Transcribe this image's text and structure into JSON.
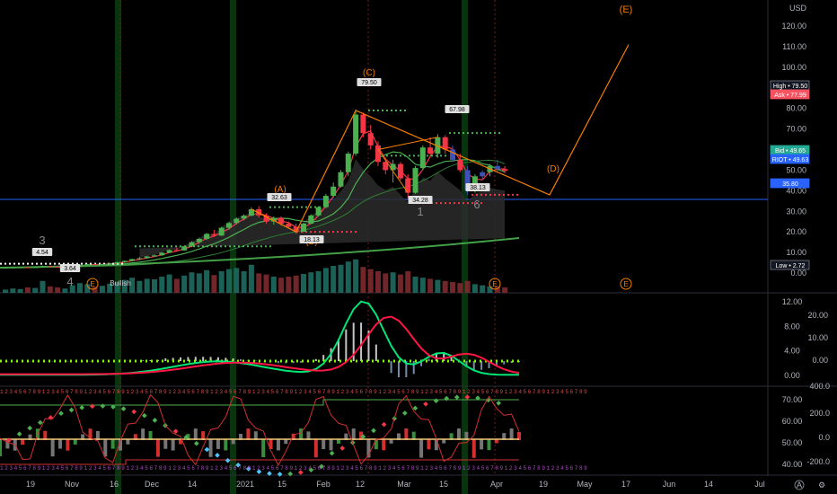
{
  "chart_data": {
    "type": "candlestick",
    "instrument": "RIOT",
    "currency_label": "USD",
    "price_axis": {
      "ticks": [
        "120.00",
        "110.00",
        "100.00",
        "90.00",
        "80.00",
        "70.00",
        "60.00",
        "50.00",
        "40.00",
        "30.00",
        "20.00",
        "10.00",
        "0.00"
      ],
      "ylim": [
        0,
        120
      ]
    },
    "time_axis_labels": [
      "19",
      "Nov",
      "16",
      "Dec",
      "14",
      "2021",
      "15",
      "Feb",
      "12",
      "Mar",
      "15",
      "Apr",
      "19",
      "May",
      "17",
      "Jun",
      "14",
      "Jul"
    ],
    "price_tags": [
      {
        "label": "High",
        "value": "79.50",
        "color": "#131722",
        "border": "#787b86"
      },
      {
        "label": "Ask",
        "value": "77.99",
        "color": "#f7525f",
        "border": "#f7525f"
      },
      {
        "label": "Bid",
        "value": "49.65",
        "color": "#22ab94",
        "border": "#22ab94"
      },
      {
        "label": "RIOT",
        "value": "49.63",
        "color": "#2962ff",
        "border": "#2962ff"
      },
      {
        "label": "",
        "value": "35.80",
        "color": "#2962ff",
        "border": "#2962ff"
      },
      {
        "label": "Low",
        "value": "2.72",
        "color": "#131722",
        "border": "#787b86"
      }
    ],
    "horizontal_line": 35.8,
    "candles": [
      [
        2.6,
        2.7,
        2.5,
        2.65
      ],
      [
        2.65,
        2.8,
        2.6,
        2.75
      ],
      [
        2.75,
        2.9,
        2.7,
        2.8
      ],
      [
        2.8,
        2.9,
        2.6,
        2.7
      ],
      [
        2.7,
        3.0,
        2.6,
        2.9
      ],
      [
        2.9,
        3.6,
        2.8,
        3.4
      ],
      [
        3.4,
        3.5,
        3.0,
        3.1
      ],
      [
        3.1,
        3.2,
        2.9,
        3.0
      ],
      [
        3.0,
        3.2,
        2.9,
        3.1
      ],
      [
        3.1,
        3.6,
        3.0,
        3.5
      ],
      [
        3.5,
        4.2,
        3.4,
        4.0
      ],
      [
        4.0,
        4.5,
        3.8,
        4.3
      ],
      [
        4.3,
        4.6,
        4.0,
        4.1
      ],
      [
        4.1,
        4.5,
        3.9,
        4.4
      ],
      [
        4.4,
        4.9,
        4.2,
        4.7
      ],
      [
        4.7,
        5.5,
        4.6,
        5.3
      ],
      [
        5.3,
        6.1,
        5.1,
        5.9
      ],
      [
        5.9,
        7.0,
        5.7,
        6.8
      ],
      [
        6.8,
        7.8,
        6.2,
        7.2
      ],
      [
        7.2,
        8.4,
        7.0,
        8.1
      ],
      [
        8.1,
        9.0,
        7.8,
        8.6
      ],
      [
        8.6,
        10.2,
        8.4,
        9.9
      ],
      [
        9.9,
        11.5,
        9.6,
        11.2
      ],
      [
        11.2,
        12.4,
        10.5,
        11.0
      ],
      [
        11.0,
        13.4,
        10.8,
        13.0
      ],
      [
        13.0,
        15.5,
        12.6,
        15.0
      ],
      [
        15.0,
        17.2,
        14.2,
        16.6
      ],
      [
        16.6,
        19.5,
        16.0,
        19.0
      ],
      [
        19.0,
        21.0,
        17.5,
        18.2
      ],
      [
        18.2,
        22.5,
        18.0,
        22.0
      ],
      [
        22.0,
        25.0,
        21.0,
        24.3
      ],
      [
        24.3,
        27.0,
        23.5,
        26.4
      ],
      [
        26.4,
        28.5,
        25.6,
        27.9
      ],
      [
        27.9,
        31.9,
        27.5,
        31.0
      ],
      [
        31.0,
        32.5,
        27.0,
        28.0
      ],
      [
        28.0,
        29.0,
        24.0,
        25.0
      ],
      [
        25.0,
        27.5,
        23.5,
        26.8
      ],
      [
        26.8,
        27.5,
        23.0,
        24.0
      ],
      [
        24.0,
        25.0,
        21.5,
        22.5
      ],
      [
        22.5,
        24.0,
        19.0,
        20.1
      ],
      [
        20.1,
        24.5,
        19.8,
        24.0
      ],
      [
        24.0,
        28.5,
        23.8,
        28.0
      ],
      [
        28.0,
        32.5,
        27.5,
        32.0
      ],
      [
        32.0,
        38.5,
        31.5,
        37.5
      ],
      [
        37.5,
        44.0,
        36.5,
        42.0
      ],
      [
        42.0,
        50.0,
        41.5,
        49.0
      ],
      [
        49.0,
        59.0,
        47.0,
        58.0
      ],
      [
        58.0,
        79.5,
        57.0,
        77.0
      ],
      [
        77.0,
        78.0,
        66.0,
        68.0
      ],
      [
        68.0,
        72.0,
        60.0,
        62.0
      ],
      [
        62.0,
        64.0,
        52.0,
        54.0
      ],
      [
        54.0,
        56.0,
        48.0,
        50.0
      ],
      [
        50.0,
        55.0,
        44.0,
        53.0
      ],
      [
        53.0,
        54.0,
        45.0,
        46.0
      ],
      [
        46.0,
        48.0,
        36.5,
        39.0
      ],
      [
        39.0,
        52.0,
        38.5,
        51.0
      ],
      [
        51.0,
        62.0,
        50.0,
        61.0
      ],
      [
        61.0,
        66.0,
        57.0,
        58.0
      ],
      [
        58.0,
        67.5,
        56.0,
        66.0
      ],
      [
        66.0,
        67.0,
        58.0,
        60.0
      ],
      [
        60.0,
        62.0,
        54.0,
        55.0
      ],
      [
        55.0,
        58.0,
        49.0,
        50.0
      ],
      [
        50.0,
        52.0,
        38.0,
        40.0
      ],
      [
        40.0,
        48.0,
        39.0,
        47.0
      ],
      [
        47.0,
        50.0,
        45.0,
        49.0
      ],
      [
        49.0,
        53.0,
        47.0,
        52.0
      ],
      [
        52.0,
        55.0,
        49.0,
        50.5
      ],
      [
        50.5,
        52.0,
        48.5,
        49.63
      ]
    ],
    "wave_labels": [
      "(E)",
      "(D)",
      "(C)",
      "(B)",
      "(A)",
      "3",
      "4",
      "1",
      "6",
      "E",
      "E",
      "E"
    ],
    "marker_labels": [
      "4.54",
      "3.64",
      "32.63",
      "18.13",
      "79.50",
      "34.28",
      "67.98",
      "38.13",
      "Bullish"
    ],
    "macd_axis": [
      "12.00",
      "8.00",
      "4.00",
      "0.00"
    ],
    "macd_right_axis": [
      "20.00",
      "10.00",
      "0.00"
    ],
    "td_axis": [
      "400.0",
      "200.0",
      "0.0",
      "-200.0"
    ],
    "td_left_axis": [
      "70.00",
      "60.00",
      "50.00",
      "40.00"
    ]
  }
}
